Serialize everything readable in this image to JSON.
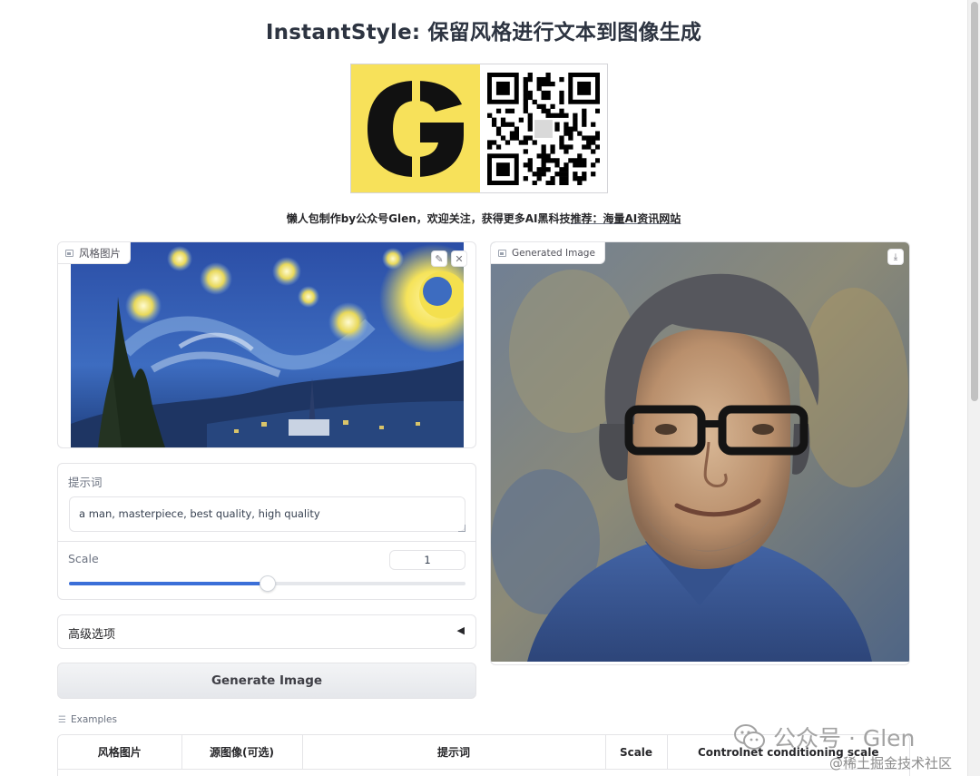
{
  "header": {
    "title": "InstantStyle: 保留风格进行文本到图像生成",
    "byline": "懒人包制作by公众号Glen，欢迎关注，获得更多AI黑科技",
    "link_text": "推荐：海量AI资讯网站"
  },
  "style_image": {
    "label": "风格图片",
    "edit_icon": "pencil-icon",
    "clear_icon": "close-icon"
  },
  "prompt": {
    "label": "提示词",
    "value": "a man, masterpiece, best quality, high quality"
  },
  "scale": {
    "label": "Scale",
    "value": "1",
    "slider_fraction": 0.5
  },
  "advanced": {
    "label": "高级选项",
    "arrow": "◀"
  },
  "generate_button": "Generate Image",
  "output": {
    "label": "Generated Image",
    "download_icon": "download-icon"
  },
  "examples": {
    "label": "Examples",
    "columns": [
      "风格图片",
      "源图像(可选)",
      "提示词",
      "Scale",
      "Controlnet conditioning scale"
    ]
  },
  "watermark": {
    "text": "公众号 · Glen",
    "site": "@稀土掘金技术社区"
  },
  "colors": {
    "accent": "#3b6fd8",
    "logo_bg": "#f7e15a"
  }
}
